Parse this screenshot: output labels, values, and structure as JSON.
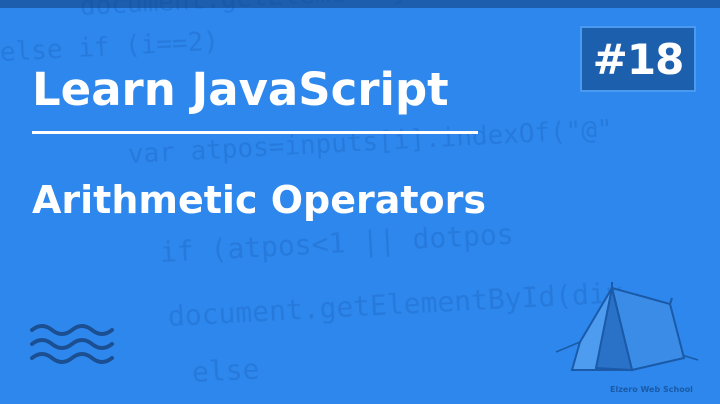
{
  "title": "Learn JavaScript",
  "subtitle": "Arithmetic Operators",
  "episode_badge": "#18",
  "logo": {
    "icon": "tent-icon",
    "label": "Elzero Web School"
  },
  "decoration": {
    "waves_icon": "waves-icon"
  },
  "background_code": [
    "document.getElementById(div",
    "else if (i==2)",
    "var atpos=inputs[i].indexOf(\"@\"",
    "if (atpos<1 || dotpos",
    "document.getElementById(div",
    "else"
  ],
  "colors": {
    "background": "#2d87ec",
    "badge": "#1c5fad",
    "text": "#ffffff"
  }
}
